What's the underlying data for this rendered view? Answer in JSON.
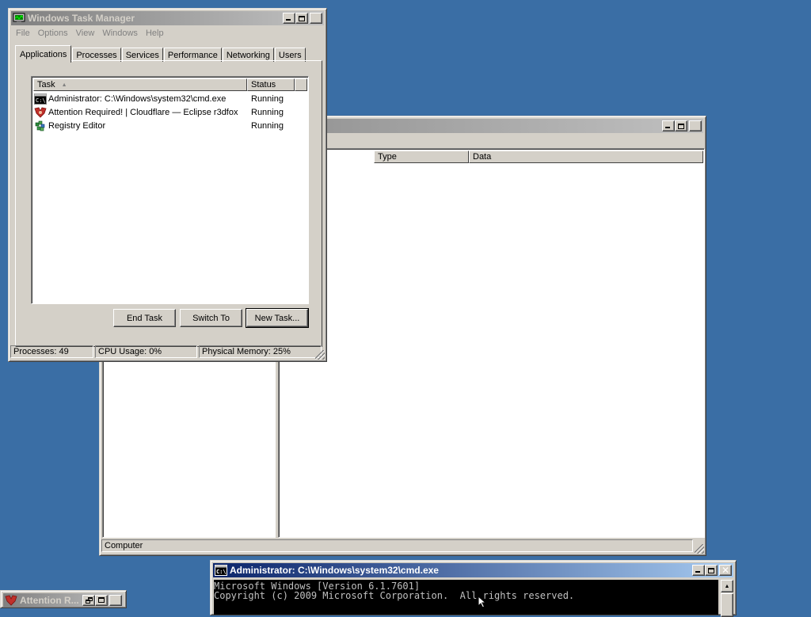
{
  "regedit": {
    "columns": {
      "type": "Type",
      "data": "Data"
    },
    "status": "Computer"
  },
  "taskmgr": {
    "title": "Windows Task Manager",
    "menu": [
      "File",
      "Options",
      "View",
      "Windows",
      "Help"
    ],
    "tabs": [
      "Applications",
      "Processes",
      "Services",
      "Performance",
      "Networking",
      "Users"
    ],
    "active_tab": "Applications",
    "columns": {
      "task": "Task",
      "status": "Status"
    },
    "rows": [
      {
        "task": "Administrator: C:\\Windows\\system32\\cmd.exe",
        "status": "Running",
        "icon": "cmd-icon"
      },
      {
        "task": "Attention Required! | Cloudflare — Eclipse r3dfox",
        "status": "Running",
        "icon": "browser-icon"
      },
      {
        "task": "Registry Editor",
        "status": "Running",
        "icon": "registry-editor-icon"
      }
    ],
    "buttons": {
      "end_task": "End Task",
      "switch_to": "Switch To",
      "new_task": "New Task..."
    },
    "statusbar": {
      "processes": "Processes: 49",
      "cpu": "CPU Usage: 0%",
      "memory": "Physical Memory: 25%"
    }
  },
  "cmd": {
    "title": "Administrator: C:\\Windows\\system32\\cmd.exe",
    "lines": [
      "Microsoft Windows [Version 6.1.7601]",
      "Copyright (c) 2009 Microsoft Corporation.  All rights reserved."
    ]
  },
  "minimized": {
    "title": "Attention R..."
  },
  "colors": {
    "desktop": "#3a6ea5",
    "active_title": "#0a246a",
    "inactive_title": "#808080",
    "face": "#d4d0c8"
  }
}
